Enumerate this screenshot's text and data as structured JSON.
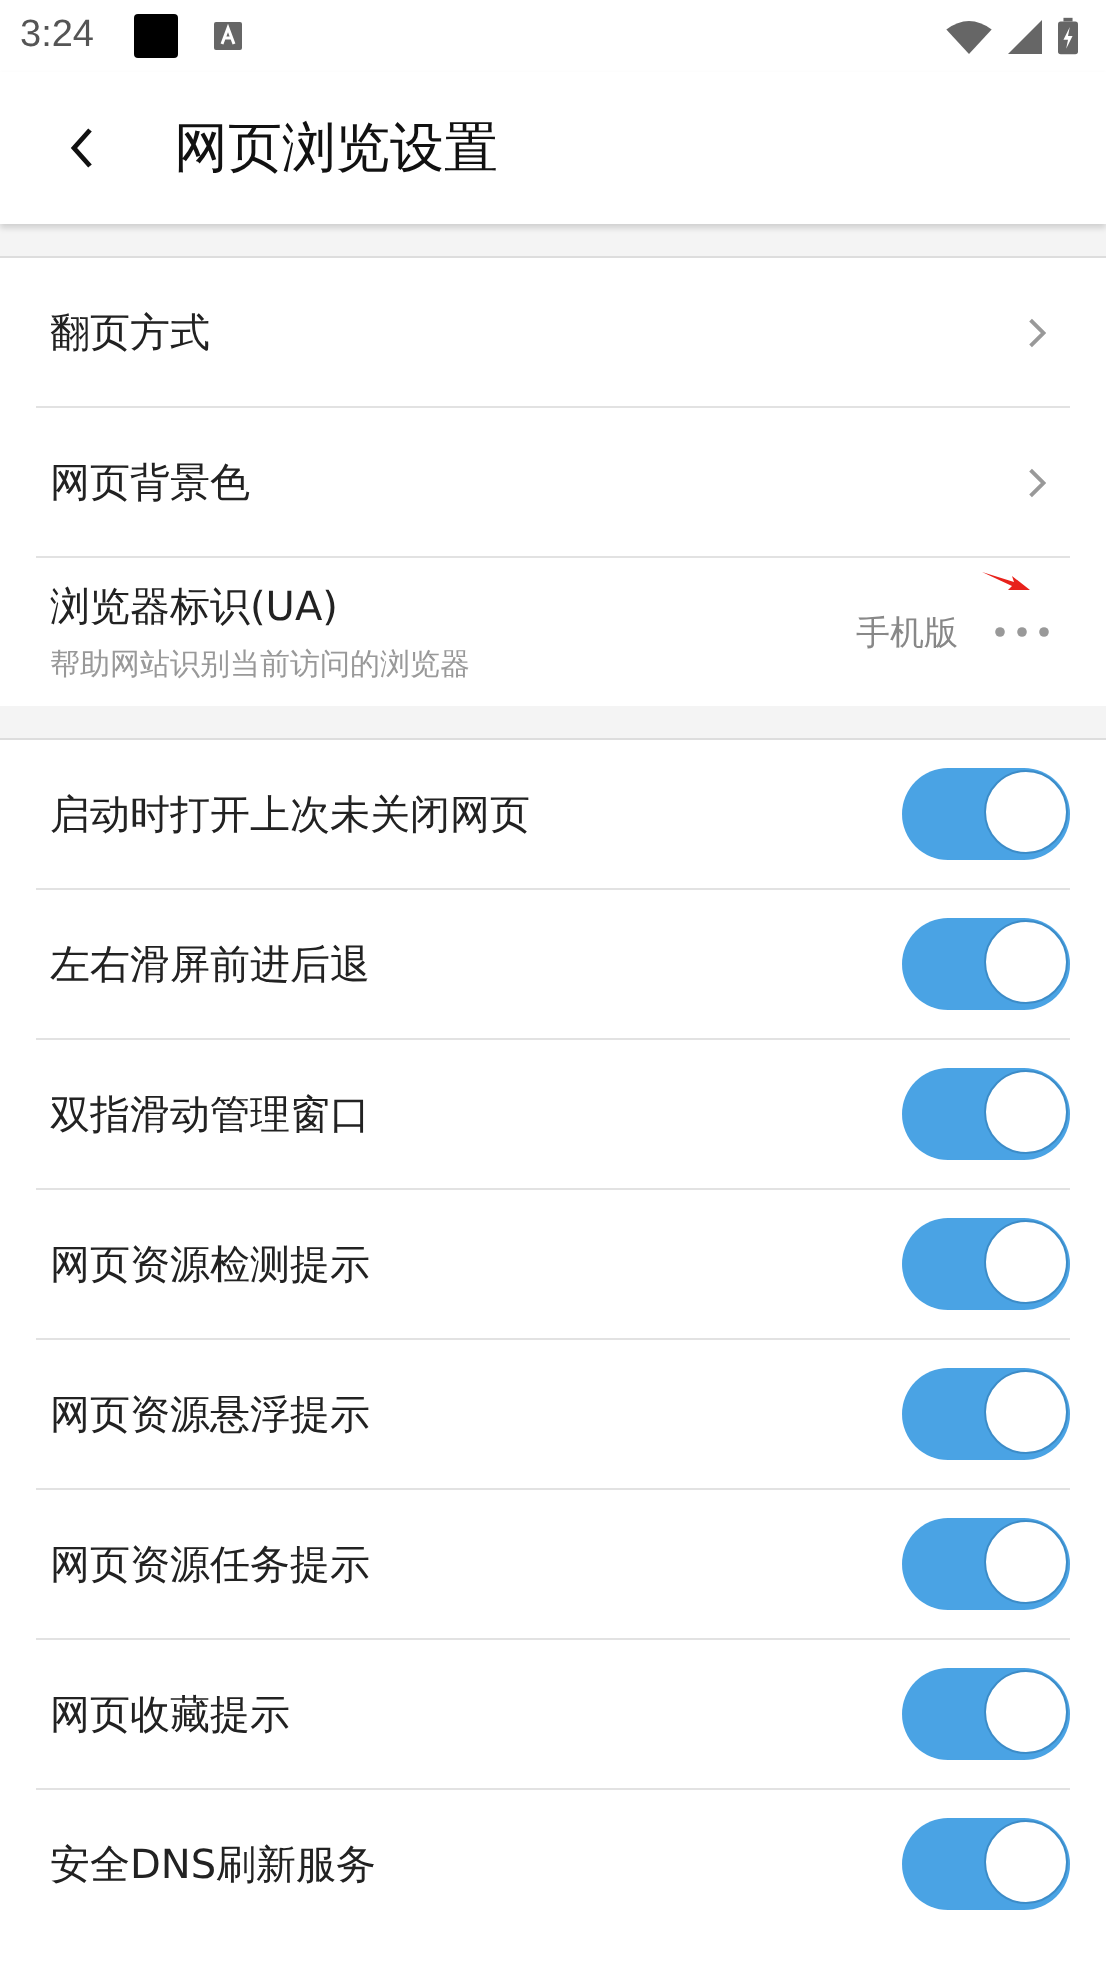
{
  "status_bar": {
    "time": "3:24"
  },
  "app_bar": {
    "title": "网页浏览设置"
  },
  "nav_items": [
    {
      "kind": "link",
      "label": "翻页方式"
    },
    {
      "kind": "link",
      "label": "网页背景色"
    },
    {
      "kind": "more",
      "label": "浏览器标识(UA)",
      "subtitle": "帮助网站识别当前访问的浏览器",
      "value": "手机版"
    }
  ],
  "toggles": [
    {
      "label": "启动时打开上次未关闭网页",
      "on": true
    },
    {
      "label": "左右滑屏前进后退",
      "on": true
    },
    {
      "label": "双指滑动管理窗口",
      "on": true
    },
    {
      "label": "网页资源检测提示",
      "on": true
    },
    {
      "label": "网页资源悬浮提示",
      "on": true
    },
    {
      "label": "网页资源任务提示",
      "on": true
    },
    {
      "label": "网页收藏提示",
      "on": true
    },
    {
      "label": "安全DNS刷新服务",
      "on": true
    }
  ]
}
